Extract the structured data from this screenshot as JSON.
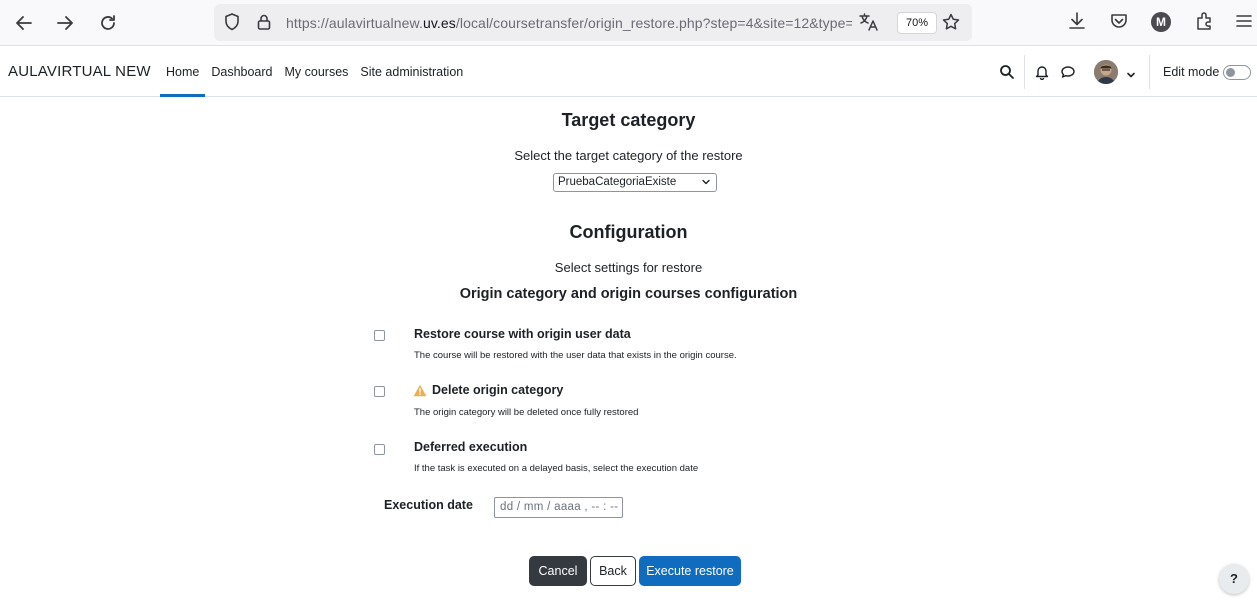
{
  "browser": {
    "url_prefix": "https://aulavirtualnew.",
    "url_domain": "uv.es",
    "url_suffix": "/local/coursetransfer/origin_restore.php?step=4&site=12&type=",
    "zoom": "70%",
    "account_initial": "M"
  },
  "navbar": {
    "brand": "AULAVIRTUAL NEW",
    "links": [
      "Home",
      "Dashboard",
      "My courses",
      "Site administration"
    ],
    "active_link": "Home",
    "edit_mode_label": "Edit mode",
    "edit_mode_on": false
  },
  "target": {
    "heading": "Target category",
    "instruction": "Select the target category of the restore",
    "selected_category": "PruebaCategoriaExiste"
  },
  "config": {
    "heading": "Configuration",
    "instruction": "Select settings for restore",
    "subheading": "Origin category and origin courses configuration",
    "options": [
      {
        "title": "Restore course with origin user data",
        "description": "The course will be restored with the user data that exists in the origin course.",
        "checked": false,
        "icon": ""
      },
      {
        "title": "Delete origin category",
        "description": "The origin category will be deleted once fully restored",
        "checked": false,
        "icon": "warning-icon"
      },
      {
        "title": "Deferred execution",
        "description": "If the task is executed on a delayed basis, select the execution date",
        "checked": false,
        "icon": ""
      }
    ],
    "execution_date_label": "Execution date",
    "execution_date_placeholder": "dd / mm / aaaa ,  -- : --"
  },
  "buttons": {
    "cancel": "Cancel",
    "back": "Back",
    "execute": "Execute restore"
  },
  "help": "?",
  "colors": {
    "primary": "#0f6cbf",
    "dark_button": "#343a40",
    "warning": "#f0ad4e"
  }
}
